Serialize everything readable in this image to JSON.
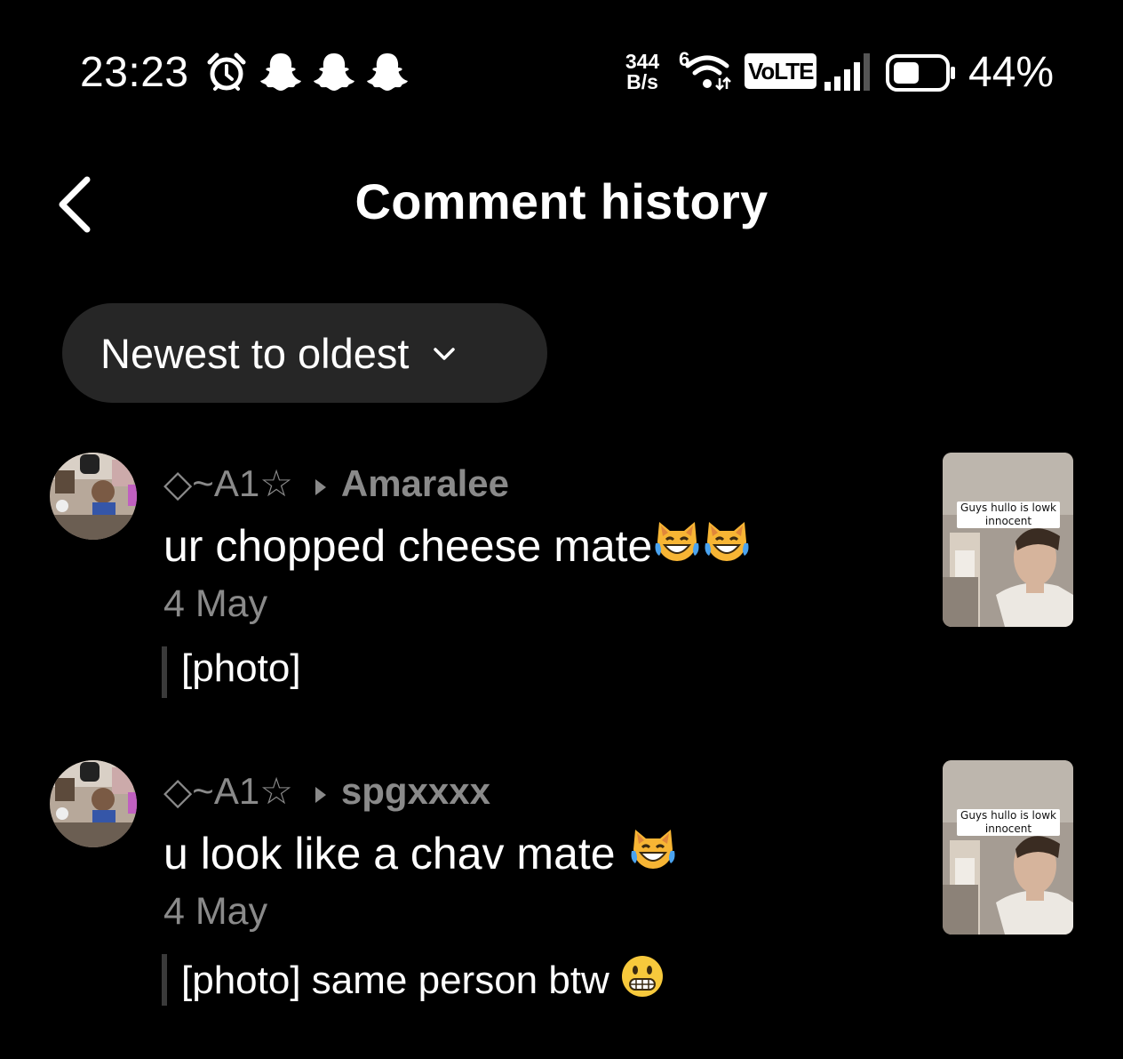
{
  "status_bar": {
    "time": "23:23",
    "net_speed_value": "344",
    "net_speed_unit": "B/s",
    "network_type": "6",
    "volte_label": "VoLTE",
    "battery_percent": "44%",
    "icons": [
      "alarm-icon",
      "snapchat-ghost-icon",
      "snapchat-ghost-icon",
      "snapchat-ghost-icon",
      "wifi-icon",
      "signal-icon",
      "battery-icon"
    ]
  },
  "header": {
    "title": "Comment history",
    "back_icon": "chevron-left-icon"
  },
  "sort": {
    "label": "Newest to oldest",
    "icon": "chevron-down-icon"
  },
  "comments": [
    {
      "author": "◇~A1☆",
      "target": "Amaralee",
      "text": "ur chopped cheese mate",
      "emojis": [
        "joy-cat",
        "joy-cat"
      ],
      "date": "4 May",
      "reply_quote": "[photo]",
      "thumbnail_caption": "Guys hullo is lowk innocent"
    },
    {
      "author": "◇~A1☆",
      "target": "spgxxxx",
      "text": "u look like a chav mate ",
      "emojis": [
        "joy-cat"
      ],
      "date": "4 May",
      "reply_quote": "[photo] same person btw ",
      "reply_emoji": "grimacing",
      "thumbnail_caption": "Guys hullo is lowk innocent"
    }
  ],
  "colors": {
    "background": "#000000",
    "pill": "#262626",
    "muted_text": "#8a8a8a",
    "primary_text": "#ffffff"
  }
}
